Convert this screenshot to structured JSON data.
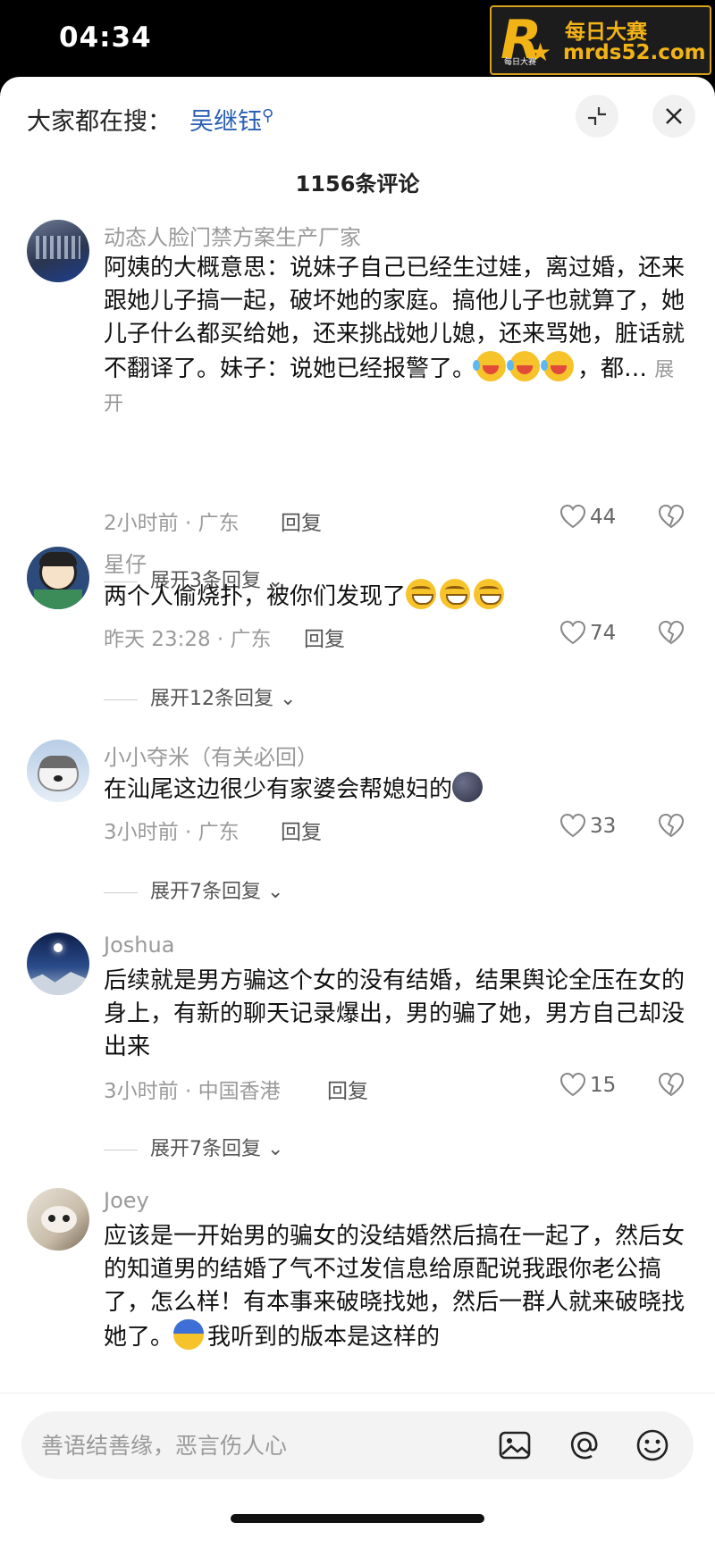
{
  "status": {
    "time": "04:34"
  },
  "watermark": {
    "letter": "R",
    "star": "★",
    "small": "每日大赛",
    "line1": "每日大赛",
    "line2": "mrds52.com"
  },
  "header": {
    "search_hint": "大家都在搜：",
    "search_term": "吴继钰",
    "search_icon": "search-icon",
    "minimize_icon": "collapse-icon",
    "close_icon": "close-icon",
    "comment_count": "1156条评论"
  },
  "comments": [
    {
      "user": "动态人脸门禁方案生产厂家",
      "text": "阿姨的大概意思：说妹子自己已经生过娃，离过婚，还来跟她儿子搞一起，破坏她的家庭。搞他儿子也就算了，她儿子什么都买给她，还来挑战她儿媳，还来骂她，脏话就不翻译了。妹子：说她已经报警了。",
      "text_tail": "，都…",
      "more": "展开",
      "meta": "2小时前 · 广东",
      "reply": "回复",
      "likes": "44",
      "expand": "展开3条回复"
    },
    {
      "user": "星仔",
      "text": "两个人偷烧扑，被你们发现了",
      "meta": "昨天 23:28 · 广东",
      "reply": "回复",
      "likes": "74",
      "expand": "展开12条回复"
    },
    {
      "user": "小小夺米（有关必回）",
      "text": "在汕尾这边很少有家婆会帮媳妇的",
      "meta": "3小时前 · 广东",
      "reply": "回复",
      "likes": "33",
      "expand": "展开7条回复"
    },
    {
      "user": "Joshua",
      "text": "后续就是男方骗这个女的没有结婚，结果舆论全压在女的身上，有新的聊天记录爆出，男的骗了她，男方自己却没出来",
      "meta": "3小时前 · 中国香港",
      "reply": "回复",
      "likes": "15",
      "expand": "展开7条回复"
    },
    {
      "user": "Joey",
      "text_a": "应该是一开始男的骗女的没结婚然后搞在一起了，然后女的知道男的结婚了气不过发信息给原配说我跟你老公搞了，怎么样！有本事来破晓找她，然后一群人就来破晓找她了。",
      "text_b": "我听到的版本是这样的"
    }
  ],
  "composer": {
    "placeholder": "善语结善缘，恶言伤人心",
    "image_icon": "image-icon",
    "at_icon": "at-icon",
    "emoji_icon": "emoji-icon"
  },
  "colors": {
    "link": "#2b5fb4",
    "muted": "#9a9a9a",
    "watermark": "#f2b316"
  }
}
